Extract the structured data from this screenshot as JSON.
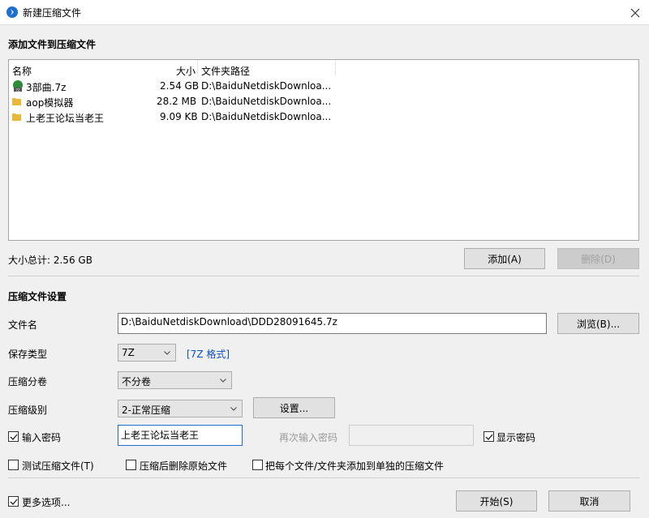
{
  "window": {
    "title": "新建压缩文件",
    "close_label": "×"
  },
  "add_section": {
    "title": "添加文件到压缩文件",
    "columns": [
      "名称",
      "大小",
      "文件夹路径"
    ],
    "rows": [
      {
        "name": "3部曲.7z",
        "size": "2.54 GB",
        "path": "D:\\BaiduNetdiskDownloa...",
        "icon": "7z-archive-icon"
      },
      {
        "name": "aop模拟器",
        "size": "28.2 MB",
        "path": "D:\\BaiduNetdiskDownloa...",
        "icon": "folder-icon"
      },
      {
        "name": "上老王论坛当老王",
        "size": "9.09 KB",
        "path": "D:\\BaiduNetdiskDownloa...",
        "icon": "folder-icon"
      }
    ],
    "total_size": "大小总计: 2.56 GB",
    "add_button": "添加(A)",
    "delete_button": "删除(D)"
  },
  "settings": {
    "title": "压缩文件设置",
    "filename_label": "文件名",
    "filename_value": "D:\\BaiduNetdiskDownload\\DDD28091645.7z",
    "browse_button": "浏览(B)...",
    "save_type_label": "保存类型",
    "save_type_value": "7Z",
    "format_link": "[7Z 格式]",
    "split_label": "压缩分卷",
    "split_value": "不分卷",
    "level_label": "压缩级别",
    "level_value": "2-正常压缩",
    "settings_button": "设置...",
    "password_label": "输入密码",
    "password_value": "上老王论坛当老王",
    "password_checked": true,
    "reenter_label": "再次输入密码",
    "reenter_value": "",
    "show_password_label": "显示密码",
    "show_password_checked": true,
    "test_label": "测试压缩文件(T)",
    "test_checked": false,
    "delete_after_label": "压缩后删除原始文件",
    "delete_after_checked": false,
    "each_file_label": "把每个文件/文件夹添加到单独的压缩文件",
    "each_file_checked": false
  },
  "footer": {
    "more_options_label": "更多选项...",
    "more_options_checked": true,
    "start_button": "开始(S)",
    "cancel_button": "取消"
  },
  "colors": {
    "accent": "#1c6fd0",
    "link": "#0f4fc0",
    "folder": "#e8b83a"
  }
}
